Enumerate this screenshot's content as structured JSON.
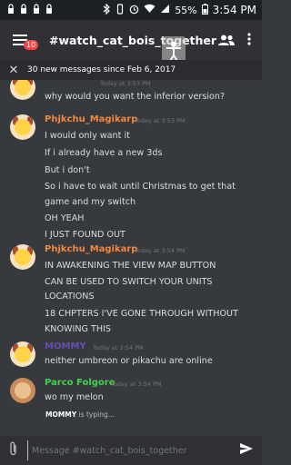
{
  "status_bar": {
    "time": "3:54 PM",
    "battery": "55%",
    "icons": [
      "lock-icon",
      "lock-icon",
      "lock-icon",
      "lock-icon",
      "bluetooth-icon",
      "vibrate-icon",
      "alarm-icon",
      "wifi-icon",
      "signal-icon",
      "battery-icon"
    ]
  },
  "app_bar": {
    "channel_name": "#watch_cat_bois_together",
    "notification_count": "10"
  },
  "banner": {
    "text": "30 new messages since Feb 6, 2017"
  },
  "messages": [
    {
      "author": "",
      "timestamp": "Today at 3:53 PM",
      "author_color": "#7c5cc4",
      "lines": [
        "why would you want the inferior version?"
      ]
    },
    {
      "author": "Phjkchu_Magikarp",
      "timestamp": "Today at 3:53 PM",
      "author_color": "#f0883e",
      "lines": [
        "I would only want it",
        "If i already have a new 3ds",
        "But i don't",
        "So i have to wait until Christmas to get that",
        "game and my switch",
        "OH YEAH",
        "I JUST FOUND OUT"
      ]
    },
    {
      "author": "Phjkchu_Magikarp",
      "timestamp": "Today at 3:54 PM",
      "author_color": "#f0883e",
      "lines": [
        "IN AWAKENING THE VIEW MAP BUTTON",
        "CAN BE USED TO SWITCH YOUR UNITS",
        "LOCATIONS",
        "18 CHPTERS I'VE GONE THROUGH WITHOUT",
        "KNOWING THIS"
      ]
    },
    {
      "author": "MOMMY",
      "timestamp": "Today at 3:54 PM",
      "author_color": "#6a4fb0",
      "lines": [
        "neither umbreon or pikachu are online"
      ]
    },
    {
      "author": "Parco Folgore",
      "timestamp": "Today at 3:54 PM",
      "author_color": "#43d24c",
      "lines": [
        "wo my melon"
      ]
    }
  ],
  "typing": {
    "user": "MOMMY",
    "text": "is typing..."
  },
  "input": {
    "placeholder": "Message #watch_cat_bois_together"
  }
}
